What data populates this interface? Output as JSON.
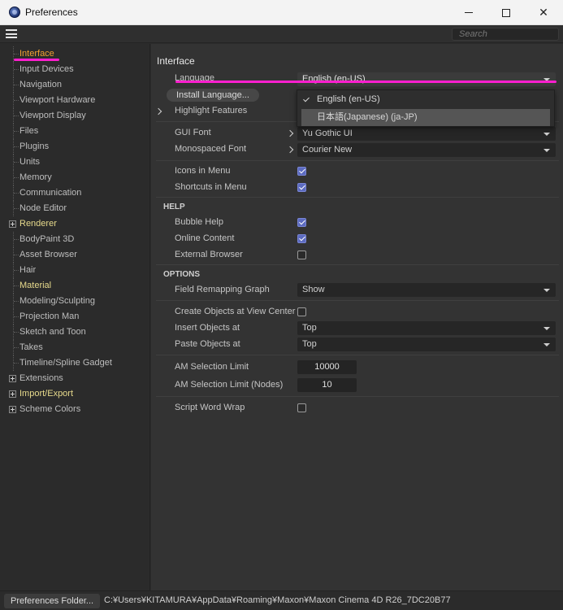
{
  "window": {
    "title": "Preferences"
  },
  "toolbar": {
    "search_placeholder": "Search"
  },
  "sidebar": {
    "items": [
      {
        "label": "Interface",
        "style": "active"
      },
      {
        "label": "Input Devices",
        "style": "normal"
      },
      {
        "label": "Navigation",
        "style": "normal"
      },
      {
        "label": "Viewport Hardware",
        "style": "normal"
      },
      {
        "label": "Viewport Display",
        "style": "normal"
      },
      {
        "label": "Files",
        "style": "normal"
      },
      {
        "label": "Plugins",
        "style": "normal"
      },
      {
        "label": "Units",
        "style": "normal"
      },
      {
        "label": "Memory",
        "style": "normal"
      },
      {
        "label": "Communication",
        "style": "normal"
      },
      {
        "label": "Node Editor",
        "style": "normal"
      },
      {
        "label": "Renderer",
        "style": "yellow",
        "expander": true
      },
      {
        "label": "BodyPaint 3D",
        "style": "normal"
      },
      {
        "label": "Asset Browser",
        "style": "normal"
      },
      {
        "label": "Hair",
        "style": "normal"
      },
      {
        "label": "Material",
        "style": "yellow"
      },
      {
        "label": "Modeling/Sculpting",
        "style": "normal"
      },
      {
        "label": "Projection Man",
        "style": "normal"
      },
      {
        "label": "Sketch and Toon",
        "style": "normal"
      },
      {
        "label": "Takes",
        "style": "normal"
      },
      {
        "label": "Timeline/Spline Gadget",
        "style": "normal"
      },
      {
        "label": "Extensions",
        "style": "normal",
        "expander": true
      },
      {
        "label": "Import/Export",
        "style": "yellow",
        "expander": true
      },
      {
        "label": "Scheme Colors",
        "style": "normal",
        "expander": true
      }
    ]
  },
  "main": {
    "section_title": "Interface",
    "language_label": "Language",
    "language_value": "English (en-US)",
    "install_language": "Install Language...",
    "highlight_features": "Highlight Features",
    "gui_font_label": "GUI Font",
    "gui_font_value": "Yu Gothic UI",
    "mono_font_label": "Monospaced Font",
    "mono_font_value": "Courier New",
    "icons_in_menu": "Icons in Menu",
    "shortcuts_in_menu": "Shortcuts in Menu",
    "help_head": "HELP",
    "bubble_help": "Bubble Help",
    "online_content": "Online Content",
    "external_browser": "External Browser",
    "options_head": "OPTIONS",
    "field_remap_label": "Field Remapping Graph",
    "field_remap_value": "Show",
    "create_objects": "Create Objects at View Center",
    "insert_objects_label": "Insert Objects at",
    "insert_objects_value": "Top",
    "paste_objects_label": "Paste Objects at",
    "paste_objects_value": "Top",
    "am_limit_label": "AM Selection Limit",
    "am_limit_value": "10000",
    "am_limit_nodes_label": "AM Selection Limit (Nodes)",
    "am_limit_nodes_value": "10",
    "script_word_wrap": "Script Word Wrap"
  },
  "popup": {
    "options": [
      "English (en-US)",
      "日本語(Japanese) (ja-JP)"
    ]
  },
  "status": {
    "folder_button": "Preferences Folder...",
    "path": "C:¥Users¥KITAMURA¥AppData¥Roaming¥Maxon¥Maxon Cinema 4D R26_7DC20B77"
  },
  "colors": {
    "accent_active": "#f0a030",
    "annotation": "#ff1fcf",
    "checkbox_on": "#5c6bc0"
  }
}
